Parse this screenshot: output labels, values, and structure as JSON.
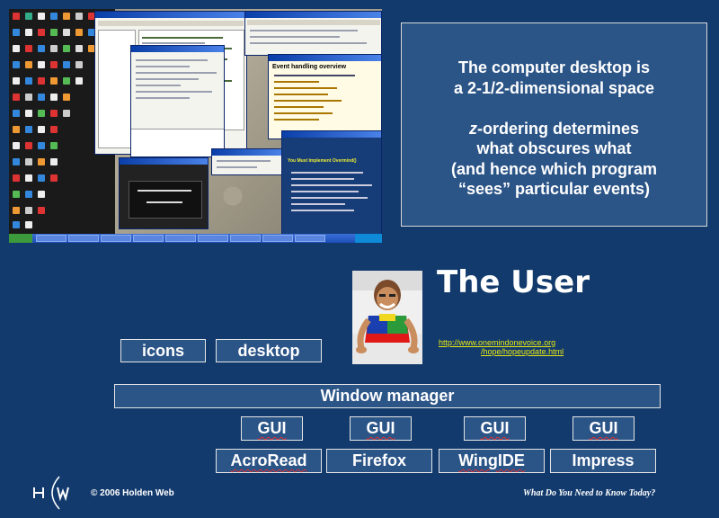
{
  "info_box": {
    "line1": "The computer desktop is",
    "line2": "a 2-1/2-dimensional space",
    "line3_em": "z",
    "line3_rest": "-ordering determines",
    "line4": "what obscures what",
    "line5": "(and hence which program",
    "line6": "“sees” particular events)"
  },
  "screenshot": {
    "window_title": "Event handling overview",
    "slide_title": "You Must Implement Overmind()"
  },
  "user": {
    "title": "The User",
    "url_line1": "http://www.onemindonevoice.org",
    "url_line2": "/hope/hopeupdate.html"
  },
  "diagram": {
    "icons": "icons",
    "desktop": "desktop",
    "window_manager": "Window manager",
    "gui": [
      "GUI",
      "GUI",
      "GUI",
      "GUI"
    ],
    "apps": [
      "AcroRead",
      "Firefox",
      "WingIDE",
      "Impress"
    ]
  },
  "footer": {
    "copyright": "© 2006 Holden Web",
    "tagline": "What Do You Need to Know Today?"
  },
  "colors": {
    "background": "#123a6c",
    "box_fill": "#2b5487",
    "url_color": "#e8e814"
  }
}
